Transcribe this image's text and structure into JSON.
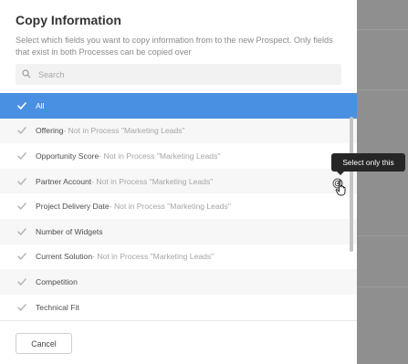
{
  "modal": {
    "title": "Copy Information",
    "description": "Select which fields you want to copy information from to the new Prospect. Only fields that exist in both Processes can be copied over",
    "search_placeholder": "Search",
    "cancel_label": "Cancel"
  },
  "fields": [
    {
      "label": "All",
      "note": "",
      "selected": true
    },
    {
      "label": "Offering",
      "note": " - Not in Process \"Marketing Leads\"",
      "selected": false
    },
    {
      "label": "Opportunity Score",
      "note": " - Not in Process \"Marketing Leads\"",
      "selected": false
    },
    {
      "label": "Partner Account",
      "note": " - Not in Process \"Marketing Leads\"",
      "selected": false
    },
    {
      "label": "Project Delivery Date",
      "note": " - Not in Process \"Marketing Leads\"",
      "selected": false
    },
    {
      "label": "Number of Widgets",
      "note": "",
      "selected": false
    },
    {
      "label": "Current Solution",
      "note": " - Not in Process \"Marketing Leads\"",
      "selected": false
    },
    {
      "label": "Competition",
      "note": "",
      "selected": false
    },
    {
      "label": "Technical Fit",
      "note": "",
      "selected": false
    }
  ],
  "tooltip": {
    "text": "Select only this"
  },
  "colors": {
    "accent": "#4a90e2",
    "overlay": "#8f8f8f",
    "tooltip_bg": "#262626"
  },
  "icons": {
    "search": "search-icon",
    "check": "checkmark-icon",
    "target": "target-icon",
    "cursor": "hand-cursor-icon"
  }
}
